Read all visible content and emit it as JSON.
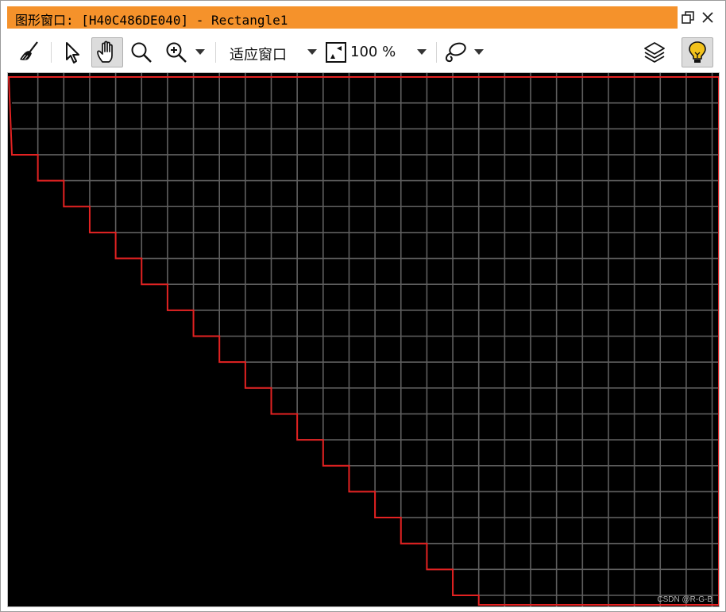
{
  "window": {
    "title": "图形窗口: [H40C486DE040] - Rectangle1",
    "title_bar_color": "#f5922b"
  },
  "toolbar": {
    "fit_window_label": "适应窗口",
    "zoom_label": "100 %",
    "icons": [
      "broom-icon",
      "pointer-icon",
      "hand-icon",
      "magnifier-icon",
      "zoom-in-icon",
      "fit-icon",
      "lasso-icon",
      "layers-icon",
      "lightbulb-icon"
    ]
  },
  "canvas": {
    "background": "#000000",
    "grid_color": "#5f5f5f",
    "region_color": "#e32222"
  },
  "watermark": "CSDN @R-G-B"
}
